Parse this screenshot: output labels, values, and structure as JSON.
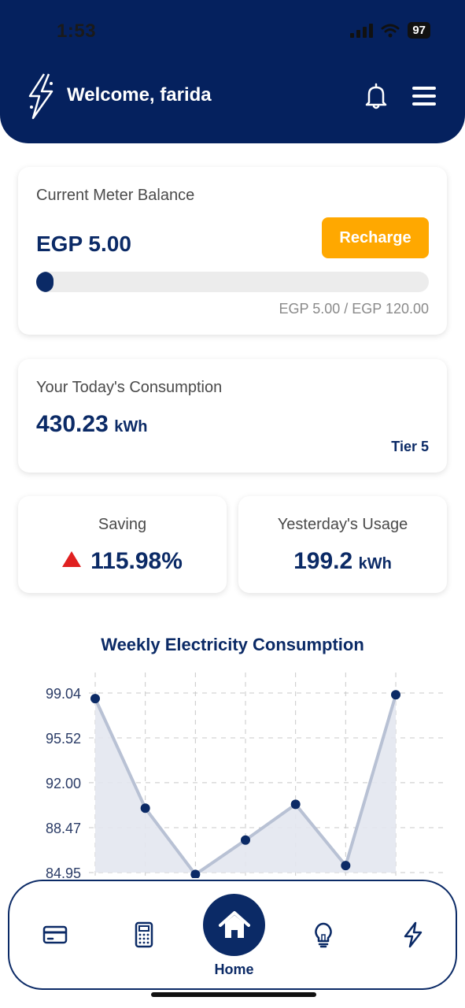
{
  "status_bar": {
    "time": "1:53",
    "battery": "97"
  },
  "header": {
    "welcome": "Welcome, farida",
    "logo_icon": "lightning-bolt-logo-icon",
    "notification_icon": "bell-icon",
    "menu_icon": "hamburger-menu-icon"
  },
  "balance_card": {
    "label": "Current Meter Balance",
    "amount": "EGP 5.00",
    "recharge_label": "Recharge",
    "progress_text": "EGP 5.00 / EGP 120.00",
    "progress_fraction": 0.0417
  },
  "consumption_card": {
    "label": "Your Today's Consumption",
    "value": "430.23",
    "unit": "kWh",
    "tier": "Tier 5"
  },
  "saving_card": {
    "label": "Saving",
    "value": "115.98%",
    "trend_icon": "up-arrow-icon"
  },
  "yesterday_card": {
    "label": "Yesterday's Usage",
    "value": "199.2",
    "unit": "kWh"
  },
  "chart_data": {
    "type": "area",
    "title": "Weekly Electricity Consumption",
    "y_ticks": [
      "99.04",
      "95.52",
      "92.00",
      "88.47",
      "84.95"
    ],
    "ylim": [
      84.95,
      99.04
    ],
    "values": [
      98.6,
      90.0,
      84.8,
      87.5,
      90.3,
      85.5,
      98.9
    ],
    "grid": true
  },
  "bottom_nav": {
    "items": [
      {
        "icon": "credit-card-icon"
      },
      {
        "icon": "calculator-icon"
      },
      {
        "icon": "home-icon",
        "label": "Home",
        "active": true
      },
      {
        "icon": "lightbulb-icon"
      },
      {
        "icon": "lightning-icon"
      }
    ]
  },
  "colors": {
    "primary": "#05215e",
    "accent": "#ffa800",
    "area_fill": "#e3e7ef",
    "line": "#b8c1d4"
  }
}
